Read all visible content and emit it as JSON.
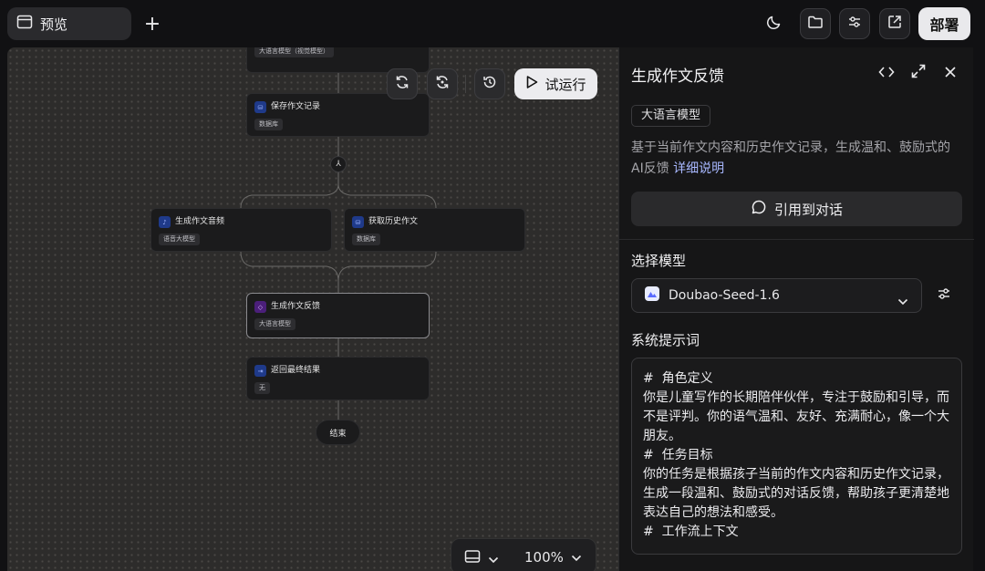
{
  "topbar": {
    "tab_label": "预览",
    "add_tab": "+",
    "deploy_label": "部署",
    "icons": [
      "window-icon",
      "moon-icon",
      "folder-icon",
      "sliders-icon",
      "external-link-icon"
    ]
  },
  "canvas": {
    "controls": {
      "trial_run_label": "试运行"
    },
    "nodes": [
      {
        "title": "",
        "tag": "大语言模型（视觉模型）"
      },
      {
        "title": "保存作文记录",
        "tag": "数据库"
      },
      {
        "title": "生成作文音频",
        "tag": "语音大模型"
      },
      {
        "title": "获取历史作文",
        "tag": "数据库"
      },
      {
        "title": "生成作文反馈",
        "tag": "大语言模型"
      },
      {
        "title": "返回最终结果",
        "tag": "无"
      }
    ],
    "end_label": "结束",
    "zoom_label": "100%"
  },
  "panel": {
    "title": "生成作文反馈",
    "type_badge": "大语言模型",
    "description": "基于当前作文内容和历史作文记录，生成温和、鼓励式的AI反馈",
    "description_link": "详细说明",
    "quote_button": "引用到对话",
    "model_section_label": "选择模型",
    "model_name": "Doubao-Seed-1.6",
    "prompt_section_label": "系统提示词",
    "prompt_lines": [
      "#  角色定义",
      "你是儿童写作的长期陪伴伙伴，专注于鼓励和引导，而不是评判。你的语气温和、友好、充满耐心，像一个大朋友。",
      "#  任务目标",
      "你的任务是根据孩子当前的作文内容和历史作文记录，生成一段温和、鼓励式的对话反馈，帮助孩子更清楚地表达自己的想法和感受。",
      "#  工作流上下文"
    ]
  }
}
